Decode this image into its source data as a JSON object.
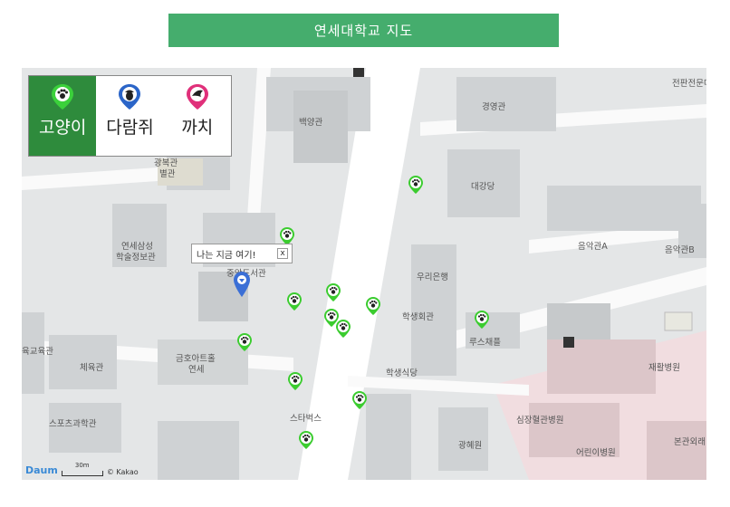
{
  "header": {
    "title": "연세대학교 지도"
  },
  "filter": {
    "options": [
      {
        "label": "고양이",
        "icon": "paw-pin-icon",
        "color": "#3bbf3b",
        "active": true
      },
      {
        "label": "다람쥐",
        "icon": "acorn-pin-icon",
        "color": "#2b65c8",
        "active": false
      },
      {
        "label": "까치",
        "icon": "wing-pin-icon",
        "color": "#e0307a",
        "active": false
      }
    ]
  },
  "map": {
    "labels": {
      "baekyang": "백양관",
      "gyeongyeong": "경영관",
      "jeonmun": "전판전문대",
      "daegang": "대강당",
      "gwangbok": "광복관",
      "byeolgwan": "별관",
      "samsung": "연세삼성",
      "samsung2": "학술정보관",
      "jungang": "중앙도서관",
      "bank": "우리은행",
      "student": "학생회관",
      "music_a": "음악관A",
      "music_b": "음악관B",
      "luce": "루스채플",
      "haksik": "학생식당",
      "kumho": "금호아트홀",
      "yonse": "연세",
      "gym": "체육관",
      "edu": "육교육관",
      "sports": "스포츠과학관",
      "starbucks": "스타벅스",
      "gwanghye": "광혜원",
      "rehab": "재활병원",
      "simjang": "심장혈관병원",
      "children": "어린이병원",
      "main_hosp": "본관외래"
    },
    "tooltip": "나는 지금 여기!",
    "tooltip_close": "x",
    "scale": "30m",
    "copyright": "© Kakao",
    "logo": "Daum"
  }
}
